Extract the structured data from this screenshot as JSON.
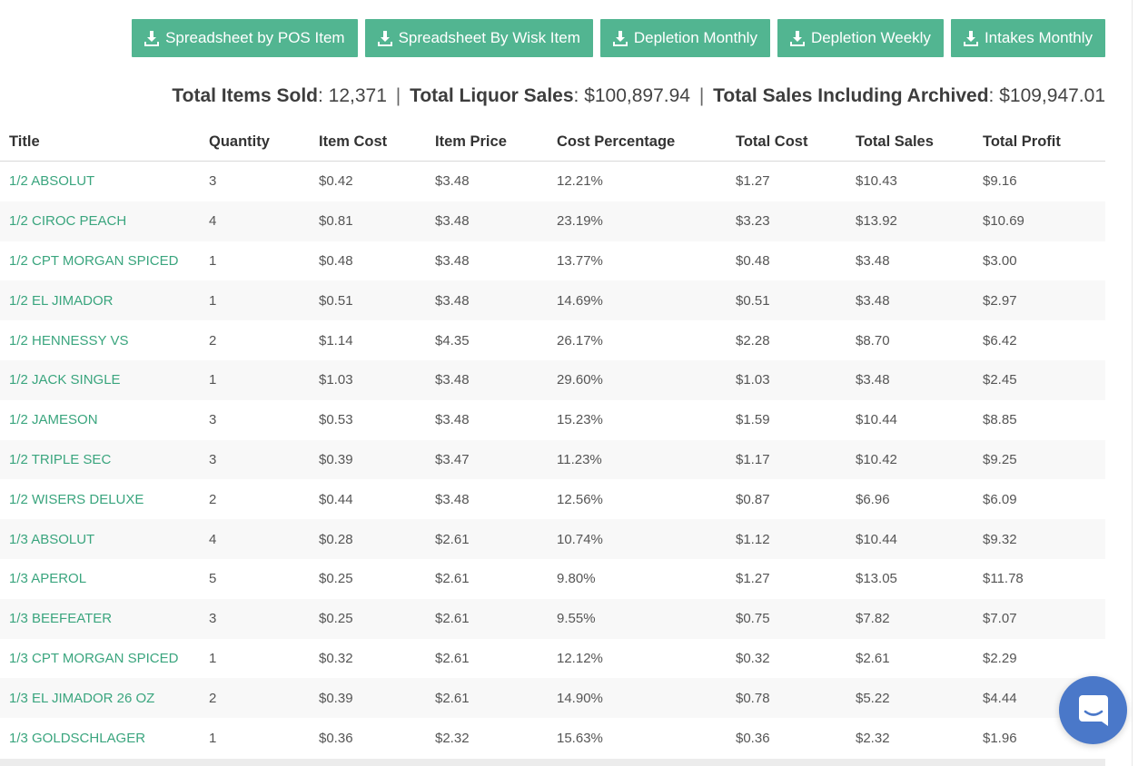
{
  "toolbar": {
    "buttons": [
      {
        "label": "Spreadsheet by POS Item",
        "icon": "download-icon"
      },
      {
        "label": "Spreadsheet By Wisk Item",
        "icon": "download-icon"
      },
      {
        "label": "Depletion Monthly",
        "icon": "download-icon"
      },
      {
        "label": "Depletion Weekly",
        "icon": "download-icon"
      },
      {
        "label": "Intakes Monthly",
        "icon": "download-icon"
      }
    ]
  },
  "totals": {
    "items_sold_label": "Total Items Sold",
    "items_sold_value": ": 12,371",
    "liquor_sales_label": "Total Liquor Sales",
    "liquor_sales_value": ": $100,897.94",
    "including_archived_label": "Total Sales Including Archived",
    "including_archived_value": ": $109,947.01",
    "separator": "|"
  },
  "table": {
    "columns": [
      "Title",
      "Quantity",
      "Item Cost",
      "Item Price",
      "Cost Percentage",
      "Total Cost",
      "Total Sales",
      "Total Profit"
    ],
    "rows": [
      [
        "1/2 ABSOLUT",
        "3",
        "$0.42",
        "$3.48",
        "12.21%",
        "$1.27",
        "$10.43",
        "$9.16"
      ],
      [
        "1/2 CIROC PEACH",
        "4",
        "$0.81",
        "$3.48",
        "23.19%",
        "$3.23",
        "$13.92",
        "$10.69"
      ],
      [
        "1/2 CPT MORGAN SPICED",
        "1",
        "$0.48",
        "$3.48",
        "13.77%",
        "$0.48",
        "$3.48",
        "$3.00"
      ],
      [
        "1/2 EL JIMADOR",
        "1",
        "$0.51",
        "$3.48",
        "14.69%",
        "$0.51",
        "$3.48",
        "$2.97"
      ],
      [
        "1/2 HENNESSY VS",
        "2",
        "$1.14",
        "$4.35",
        "26.17%",
        "$2.28",
        "$8.70",
        "$6.42"
      ],
      [
        "1/2 JACK SINGLE",
        "1",
        "$1.03",
        "$3.48",
        "29.60%",
        "$1.03",
        "$3.48",
        "$2.45"
      ],
      [
        "1/2 JAMESON",
        "3",
        "$0.53",
        "$3.48",
        "15.23%",
        "$1.59",
        "$10.44",
        "$8.85"
      ],
      [
        "1/2 TRIPLE SEC",
        "3",
        "$0.39",
        "$3.47",
        "11.23%",
        "$1.17",
        "$10.42",
        "$9.25"
      ],
      [
        "1/2 WISERS DELUXE",
        "2",
        "$0.44",
        "$3.48",
        "12.56%",
        "$0.87",
        "$6.96",
        "$6.09"
      ],
      [
        "1/3 ABSOLUT",
        "4",
        "$0.28",
        "$2.61",
        "10.74%",
        "$1.12",
        "$10.44",
        "$9.32"
      ],
      [
        "1/3 APEROL",
        "5",
        "$0.25",
        "$2.61",
        "9.80%",
        "$1.27",
        "$13.05",
        "$11.78"
      ],
      [
        "1/3 BEEFEATER",
        "3",
        "$0.25",
        "$2.61",
        "9.55%",
        "$0.75",
        "$7.82",
        "$7.07"
      ],
      [
        "1/3 CPT MORGAN SPICED",
        "1",
        "$0.32",
        "$2.61",
        "12.12%",
        "$0.32",
        "$2.61",
        "$2.29"
      ],
      [
        "1/3 EL JIMADOR 26 OZ",
        "2",
        "$0.39",
        "$2.61",
        "14.90%",
        "$0.78",
        "$5.22",
        "$4.44"
      ],
      [
        "1/3 GOLDSCHLAGER",
        "1",
        "$0.36",
        "$2.32",
        "15.63%",
        "$0.36",
        "$2.32",
        "$1.96"
      ]
    ]
  },
  "colors": {
    "accent": "#52b591",
    "link": "#3aa57e",
    "chat": "#4a78c9"
  },
  "chat": {
    "icon": "chat-bubble-icon"
  }
}
